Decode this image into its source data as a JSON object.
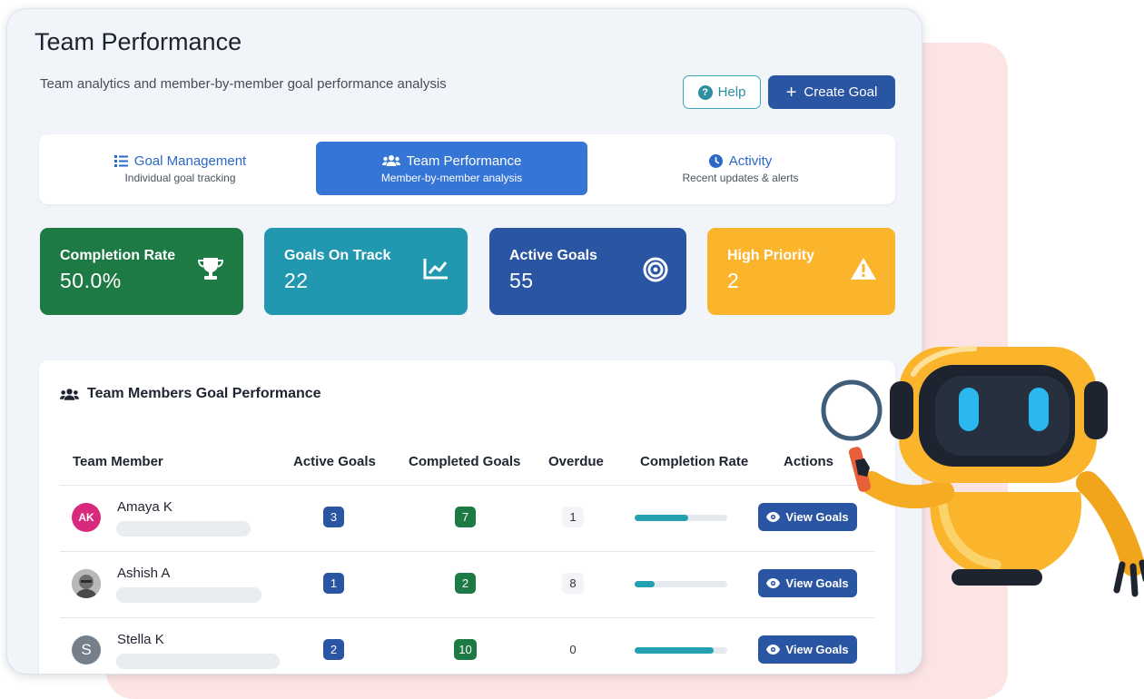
{
  "header": {
    "title": "Team Performance",
    "subtitle": "Team analytics and member-by-member goal performance analysis",
    "help_label": "Help",
    "create_label": "Create Goal"
  },
  "tabs": [
    {
      "label": "Goal Management",
      "sub": "Individual goal tracking",
      "icon": "list-icon",
      "active": false
    },
    {
      "label": "Team Performance",
      "sub": "Member-by-member analysis",
      "icon": "users-icon",
      "active": true
    },
    {
      "label": "Activity",
      "sub": "Recent updates & alerts",
      "icon": "clock-icon",
      "active": false
    }
  ],
  "stats": [
    {
      "label": "Completion Rate",
      "value": "50.0%",
      "color": "#1e7a45",
      "icon": "trophy-icon"
    },
    {
      "label": "Goals On Track",
      "value": "22",
      "color": "#2298b0",
      "icon": "chart-line-icon"
    },
    {
      "label": "Active Goals",
      "value": "55",
      "color": "#2a55a3",
      "icon": "target-icon"
    },
    {
      "label": "High Priority",
      "value": "2",
      "color": "#fbb52c",
      "icon": "warning-icon"
    }
  ],
  "panel": {
    "title": "Team Members Goal Performance",
    "columns": [
      "Team Member",
      "Active Goals",
      "Completed Goals",
      "Overdue",
      "Completion Rate",
      "Actions"
    ],
    "rows": [
      {
        "name": "Amaya K",
        "initials": "AK",
        "active": "3",
        "completed": "7",
        "overdue": "1",
        "rate": 0.58,
        "action": "View Goals"
      },
      {
        "name": "Ashish A",
        "initials": "",
        "active": "1",
        "completed": "2",
        "overdue": "8",
        "rate": 0.22,
        "action": "View Goals"
      },
      {
        "name": "Stella K",
        "initials": "S",
        "active": "2",
        "completed": "10",
        "overdue": "0",
        "rate": 0.85,
        "action": "View Goals"
      }
    ]
  },
  "colors": {
    "primary": "#2a55a3",
    "accent": "#3575d6",
    "teal": "#24a0b0",
    "green": "#1e7a45",
    "amber": "#fbb52c"
  }
}
